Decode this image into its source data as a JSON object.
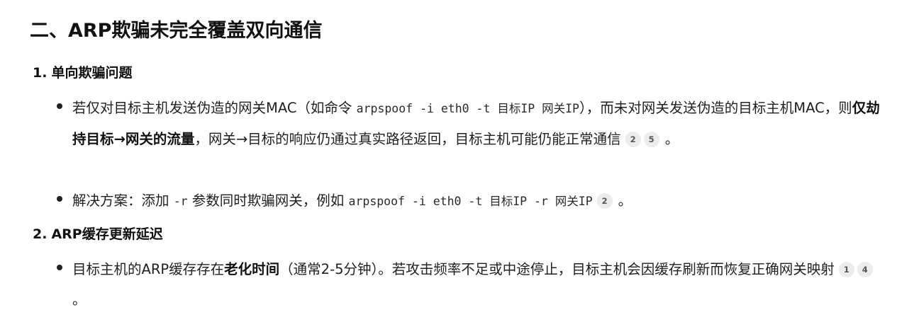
{
  "section": {
    "title": "二、ARP欺骗未完全覆盖双向通信"
  },
  "subsections": [
    {
      "number": "1.",
      "title": "单向欺骗问题",
      "bullets": [
        {
          "part1": "若仅对目标主机发送伪造的网关MAC（如命令",
          "code1": "arpspoof -i eth0 -t 目标IP 网关IP",
          "part2": "），而未对网关发送伪造的目标主机MAC，则",
          "bold1": "仅劫持目标→网关的流量",
          "part3": "，网关→目标的响应仍通过真实路径返回，目标主机可能仍能正常通信",
          "refs": [
            "2",
            "5"
          ],
          "end": "。"
        },
        {
          "part1": "解决方案：添加",
          "code1": "-r",
          "part2": "参数同时欺骗网关，例如",
          "code2": "arpspoof -i eth0 -t 目标IP -r 网关IP",
          "refs": [
            "2"
          ],
          "end": "。"
        }
      ]
    },
    {
      "number": "2.",
      "title": "ARP缓存更新延迟",
      "bullets": [
        {
          "part1": "目标主机的ARP缓存存在",
          "bold1": "老化时间",
          "part2": "（通常2-5分钟）。若攻击频率不足或中途停止，目标主机会因缓存刷新而恢复正确网关映射",
          "refs": [
            "1",
            "4"
          ],
          "end": "。"
        }
      ]
    }
  ]
}
